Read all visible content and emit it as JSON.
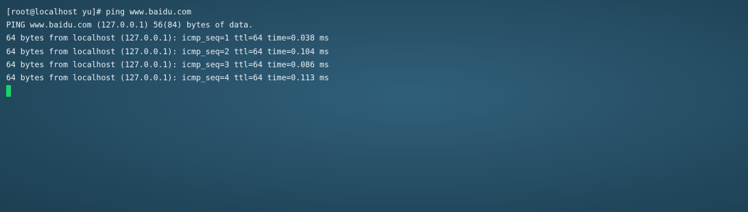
{
  "terminal": {
    "lines": [
      "[root@localhost yu]# ping www.baidu.com",
      "PING www.baidu.com (127.0.0.1) 56(84) bytes of data.",
      "64 bytes from localhost (127.0.0.1): icmp_seq=1 ttl=64 time=0.038 ms",
      "64 bytes from localhost (127.0.0.1): icmp_seq=2 ttl=64 time=0.104 ms",
      "64 bytes from localhost (127.0.0.1): icmp_seq=3 ttl=64 time=0.086 ms",
      "64 bytes from localhost (127.0.0.1): icmp_seq=4 ttl=64 time=0.113 ms"
    ],
    "cursor_color": "#19d26a",
    "background_color": "#2a546c"
  }
}
